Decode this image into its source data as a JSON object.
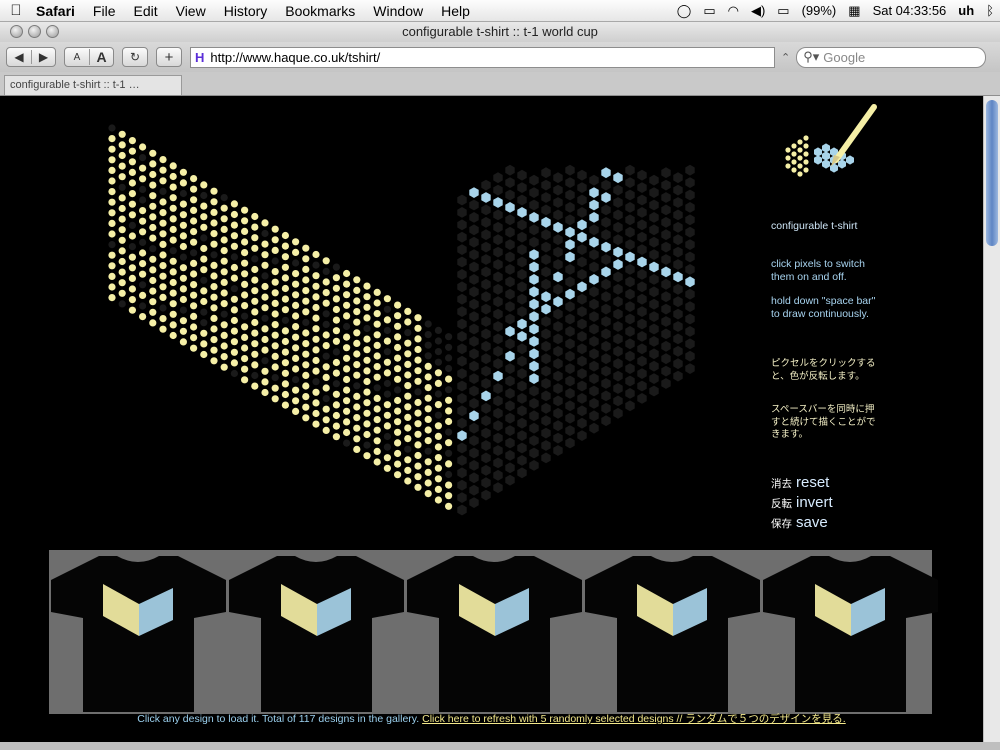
{
  "menubar": {
    "app": "Safari",
    "items": [
      "File",
      "Edit",
      "View",
      "History",
      "Bookmarks",
      "Window",
      "Help"
    ],
    "battery": "(99%)",
    "clock": "Sat 04:33:56",
    "user": "uh"
  },
  "window": {
    "title": "configurable t-shirt :: t-1 world cup"
  },
  "toolbar": {
    "back": "◀",
    "forward": "▶",
    "text_smaller": "A",
    "text_bigger": "A",
    "reload": "↻",
    "add_bookmark": "+",
    "favicon": "H",
    "url": "http://www.haque.co.uk/tshirt/",
    "search_placeholder": "Google"
  },
  "tab": {
    "label": "configurable t-shirt :: t-1 …"
  },
  "sidebar": {
    "title": "configurable t-shirt",
    "instructions_1": "click pixels to switch them on and off.",
    "instructions_2": "hold down \"space bar\" to draw continuously.",
    "instructions_jp_1": "ピクセルをクリックすると、色が反転します。",
    "instructions_jp_2": "スペースバーを同時に押すと続けて描くことができます。",
    "reset_jp": "消去",
    "reset": "reset",
    "invert_jp": "反転",
    "invert": "invert",
    "save_jp": "保存",
    "save": "save"
  },
  "footer": {
    "info": "Click any design to load it. Total of 117 designs in the gallery.",
    "refresh_link": "Click here to refresh with 5 randomly selected designs // ランダムで５つのデザインを見る."
  },
  "colors": {
    "cream": "#f5efa6",
    "blue": "#a8d4ea",
    "dark": "#1a1a1a",
    "gallery_bg": "#6e6e6e"
  }
}
